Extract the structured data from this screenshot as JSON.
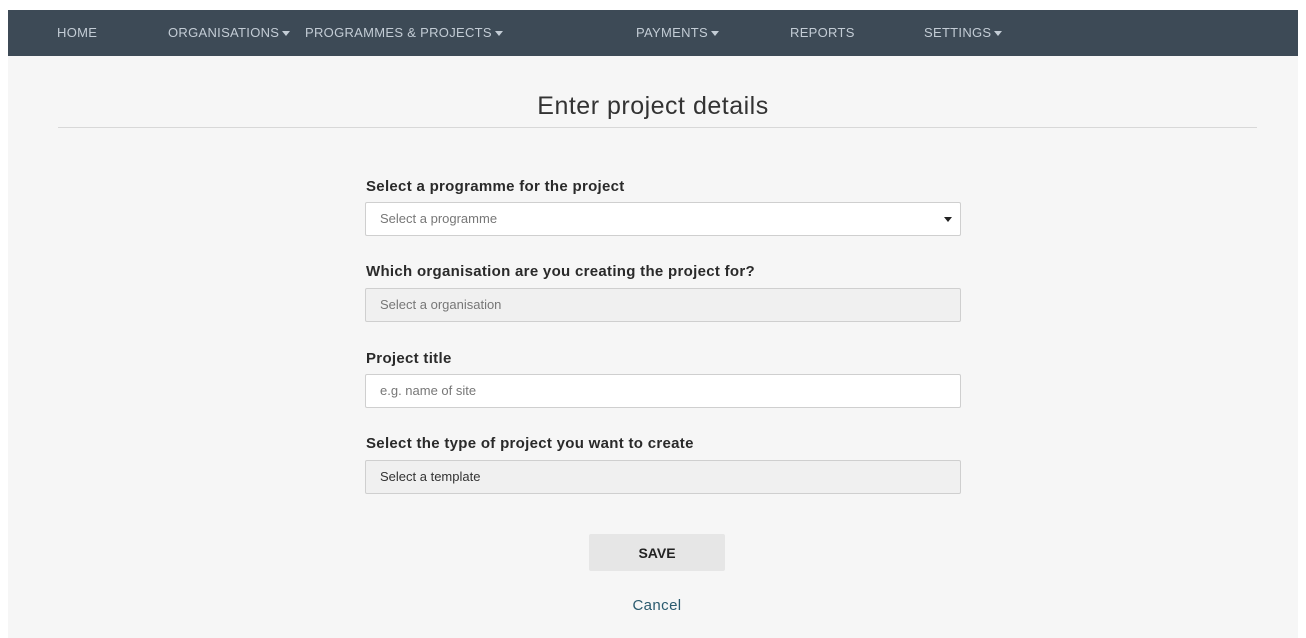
{
  "nav": {
    "items": [
      {
        "label": "HOME",
        "dropdown": false
      },
      {
        "label": "ORGANISATIONS",
        "dropdown": true
      },
      {
        "label": "PROGRAMMES & PROJECTS",
        "dropdown": true
      },
      {
        "label": "PAYMENTS",
        "dropdown": true
      },
      {
        "label": "REPORTS",
        "dropdown": false
      },
      {
        "label": "SETTINGS",
        "dropdown": true
      }
    ]
  },
  "page": {
    "title": "Enter project details"
  },
  "form": {
    "programme": {
      "label": "Select a programme for the project",
      "placeholder": "Select a programme"
    },
    "organisation": {
      "label": "Which organisation are you creating the project for?",
      "placeholder": "Select a organisation"
    },
    "project_title": {
      "label": "Project title",
      "placeholder": "e.g. name of site"
    },
    "template": {
      "label": "Select the type of project you want to create",
      "placeholder": "Select a template"
    },
    "save_label": "SAVE",
    "cancel_label": "Cancel"
  },
  "colors": {
    "nav_bg": "#3d4a56",
    "page_bg": "#f6f6f6",
    "link": "#2a5a6e"
  }
}
